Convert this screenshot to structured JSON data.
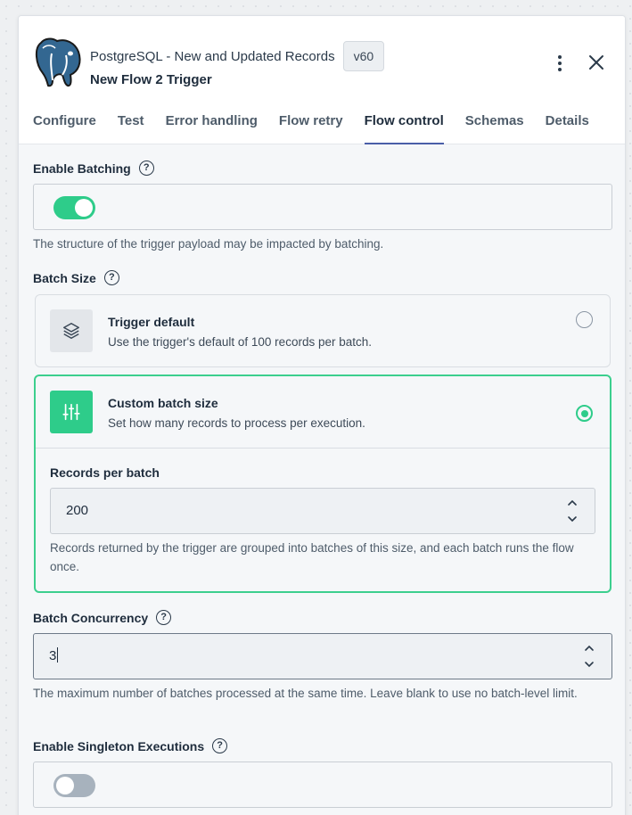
{
  "header": {
    "title": "PostgreSQL - New and Updated Records",
    "version": "v60",
    "subtitle": "New Flow 2 Trigger",
    "logo_icon": "postgresql-elephant-icon",
    "menu_icon": "kebab-menu-icon",
    "close_icon": "close-icon"
  },
  "tabs": [
    {
      "label": "Configure",
      "active": false
    },
    {
      "label": "Test",
      "active": false
    },
    {
      "label": "Error handling",
      "active": false
    },
    {
      "label": "Flow retry",
      "active": false
    },
    {
      "label": "Flow control",
      "active": true
    },
    {
      "label": "Schemas",
      "active": false
    },
    {
      "label": "Details",
      "active": false
    }
  ],
  "enable_batching": {
    "label": "Enable Batching",
    "help": "?",
    "enabled": true,
    "hint": "The structure of the trigger payload may be impacted by batching."
  },
  "batch_size": {
    "label": "Batch Size",
    "help": "?",
    "options": [
      {
        "title": "Trigger default",
        "description": "Use the trigger's default of 100 records per batch.",
        "icon": "layers-icon",
        "selected": false
      },
      {
        "title": "Custom batch size",
        "description": "Set how many records to process per execution.",
        "icon": "sliders-icon",
        "selected": true
      }
    ],
    "records_per_batch": {
      "label": "Records per batch",
      "value": "200",
      "hint": "Records returned by the trigger are grouped into batches of this size, and each batch runs the flow once."
    }
  },
  "batch_concurrency": {
    "label": "Batch Concurrency",
    "help": "?",
    "value": "3",
    "hint": "The maximum number of batches processed at the same time. Leave blank to use no batch-level limit."
  },
  "singleton": {
    "label": "Enable Singleton Executions",
    "help": "?",
    "enabled": false
  },
  "colors": {
    "accent_green": "#2ecc8a",
    "tab_underline": "#4a5ea8"
  }
}
